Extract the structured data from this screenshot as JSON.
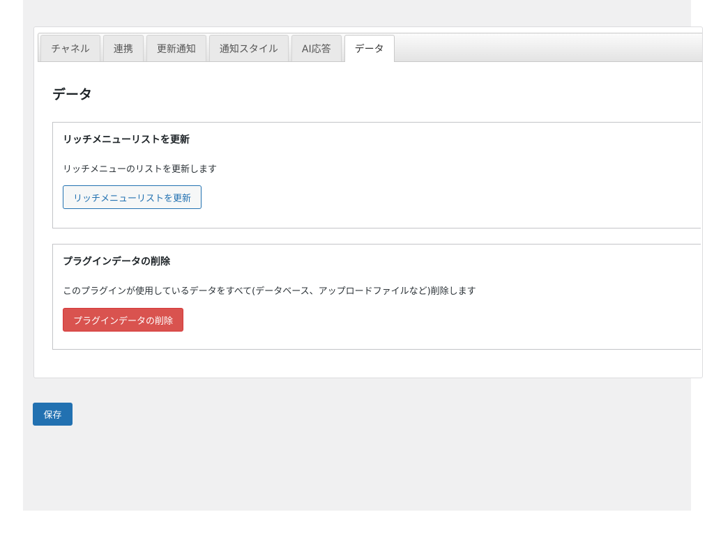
{
  "tabs": [
    {
      "label": "チャネル",
      "active": false
    },
    {
      "label": "連携",
      "active": false
    },
    {
      "label": "更新通知",
      "active": false
    },
    {
      "label": "通知スタイル",
      "active": false
    },
    {
      "label": "AI応答",
      "active": false
    },
    {
      "label": "データ",
      "active": true
    }
  ],
  "main": {
    "title": "データ",
    "sections": [
      {
        "title": "リッチメニューリストを更新",
        "description": "リッチメニューのリストを更新します",
        "button_label": "リッチメニューリストを更新"
      },
      {
        "title": "プラグインデータの削除",
        "description": "このプラグインが使用しているデータをすべて(データベース、アップロードファイルなど)削除します",
        "button_label": "プラグインデータの削除"
      }
    ]
  },
  "footer": {
    "save_label": "保存"
  },
  "colors": {
    "primary": "#2271b1",
    "danger": "#d9534f",
    "page_background": "#f0f0f1"
  }
}
